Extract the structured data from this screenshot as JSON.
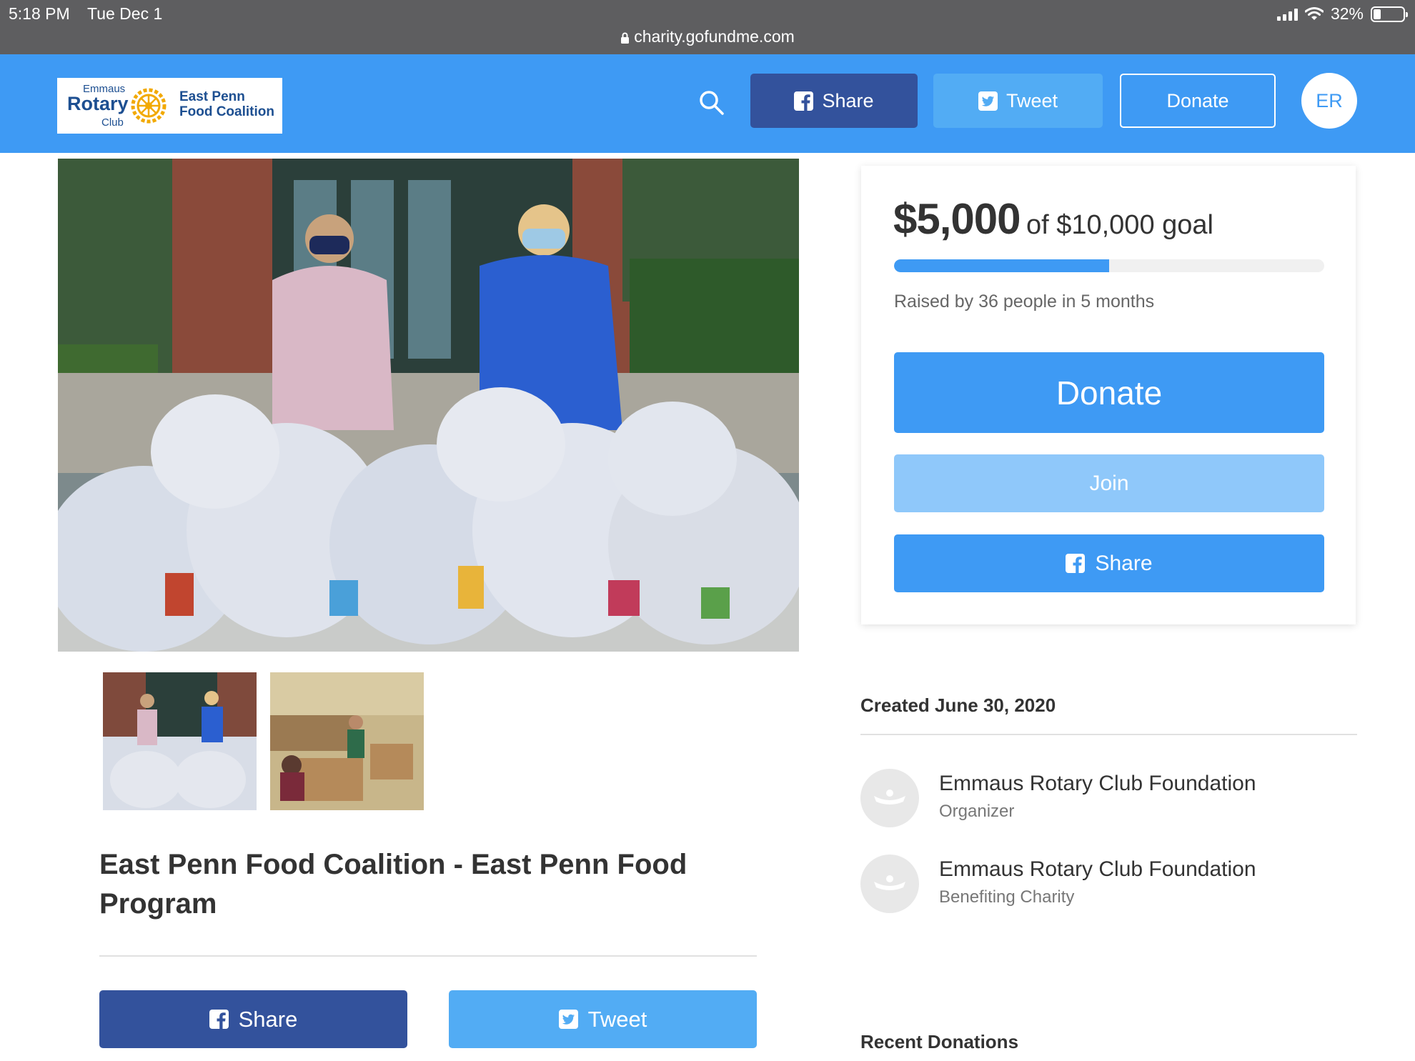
{
  "status_bar": {
    "time": "5:18 PM",
    "date": "Tue Dec 1",
    "url": "charity.gofundme.com",
    "battery": "32%",
    "battery_level": 0.32
  },
  "header": {
    "logo": {
      "emmaus": "Emmaus",
      "rotary": "Rotary",
      "club": "Club",
      "coalition_line1": "East Penn",
      "coalition_line2": "Food Coalition"
    },
    "share_label": "Share",
    "tweet_label": "Tweet",
    "donate_label": "Donate",
    "avatar_initials": "ER"
  },
  "campaign": {
    "title": "East Penn Food Coalition - East Penn Food Program",
    "share_label": "Share",
    "tweet_label": "Tweet"
  },
  "donation_card": {
    "raised_amount": "$5,000",
    "goal_text": "of $10,000 goal",
    "progress_fraction": 0.5,
    "raised_by": "Raised by 36 people in 5 months",
    "donate_label": "Donate",
    "join_label": "Join",
    "share_label": "Share"
  },
  "details": {
    "created": "Created June 30, 2020",
    "organizer": {
      "name": "Emmaus Rotary Club Foundation",
      "role": "Organizer"
    },
    "beneficiary": {
      "name": "Emmaus Rotary Club Foundation",
      "role": "Benefiting Charity"
    },
    "recent_donations_heading": "Recent Donations"
  },
  "colors": {
    "header_blue": "#3e9af4",
    "facebook_blue": "#33529c",
    "twitter_blue": "#52acf4",
    "join_light_blue": "#8fc8fa"
  }
}
